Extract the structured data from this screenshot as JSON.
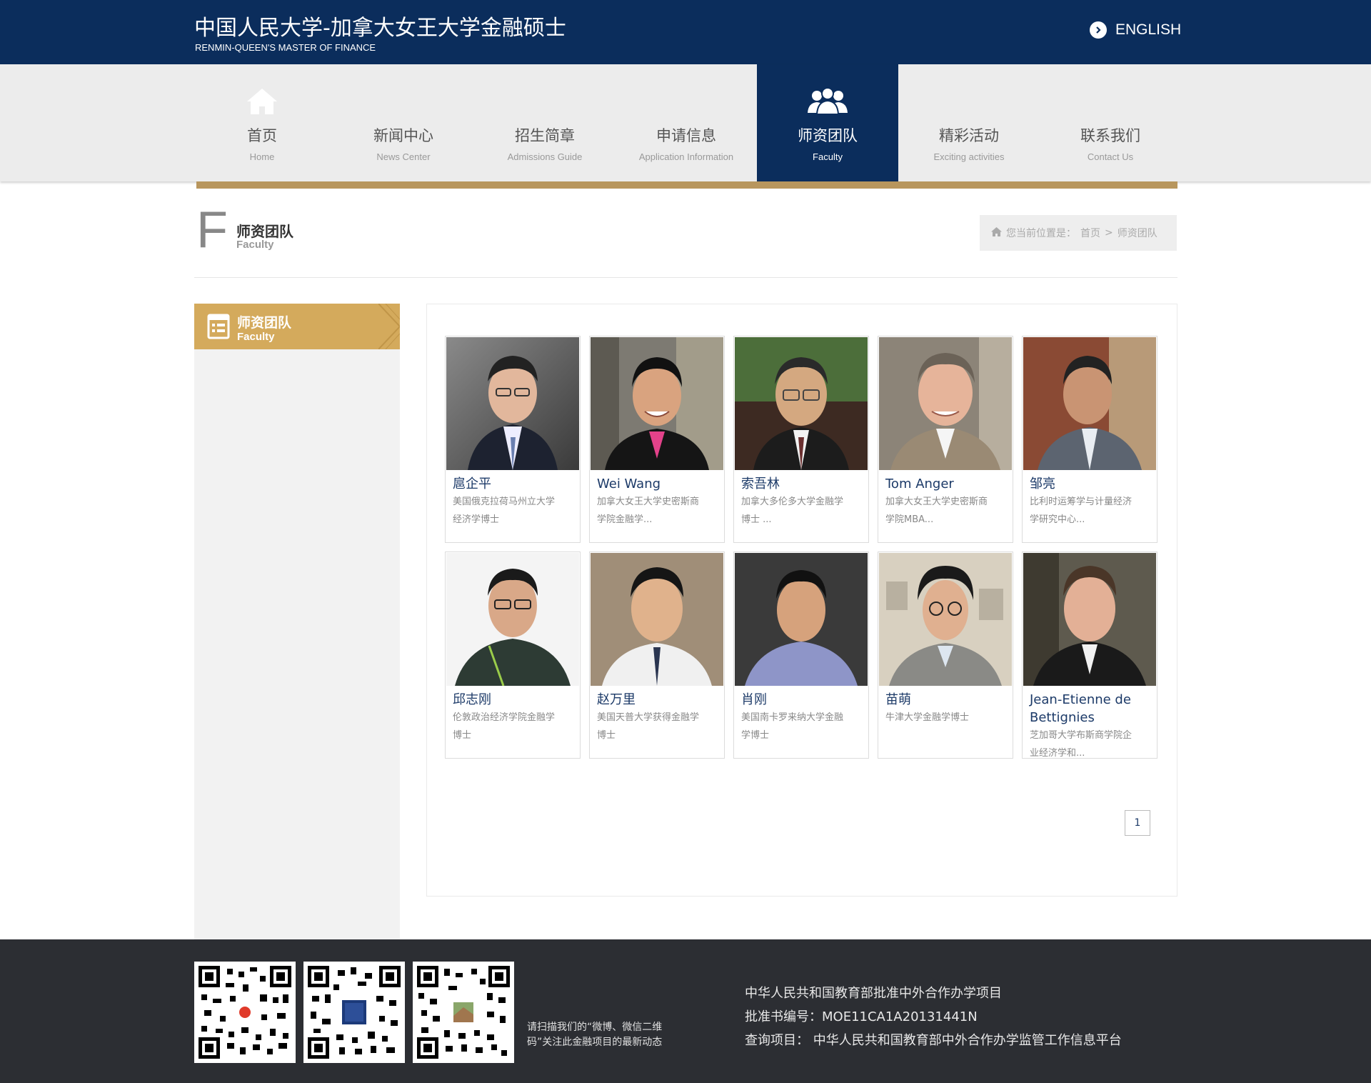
{
  "header": {
    "title": "中国人民大学-加拿大女王大学金融硕士",
    "subtitle": "RENMIN-QUEEN'S MASTER OF FINANCE",
    "language_link": "ENGLISH"
  },
  "nav": {
    "items": [
      {
        "zh": "首页",
        "en": "Home",
        "icon": "home-icon"
      },
      {
        "zh": "新闻中心",
        "en": "News Center"
      },
      {
        "zh": "招生简章",
        "en": "Admissions Guide"
      },
      {
        "zh": "申请信息",
        "en": "Application Information"
      },
      {
        "zh": "师资团队",
        "en": "Faculty",
        "icon": "faculty-group-icon",
        "active": true
      },
      {
        "zh": "精彩活动",
        "en": "Exciting activities"
      },
      {
        "zh": "联系我们",
        "en": "Contact Us"
      }
    ]
  },
  "page_title": {
    "letter": "F",
    "zh": "师资团队",
    "en": "Faculty"
  },
  "breadcrumb": {
    "prefix": "您当前位置是：",
    "home": "首页",
    "separator": ">",
    "current": "师资团队"
  },
  "sidebar": {
    "heading_zh": "师资团队",
    "heading_en": "Faculty",
    "accent_color": "#d4aa5c"
  },
  "faculty": [
    {
      "name": "扈企平",
      "desc_lines": [
        "美国俄克拉荷马州立大学",
        "经济学博士"
      ]
    },
    {
      "name": "Wei Wang",
      "desc_lines": [
        "加拿大女王大学史密斯商",
        "学院金融学..."
      ]
    },
    {
      "name": "索吾林",
      "desc_lines": [
        "加拿大多伦多大学金融学",
        "博士 ..."
      ]
    },
    {
      "name": "Tom Anger",
      "desc_lines": [
        "加拿大女王大学史密斯商",
        "学院MBA..."
      ]
    },
    {
      "name": "邹亮",
      "desc_lines": [
        "比利时运筹学与计量经济",
        "学研究中心..."
      ]
    },
    {
      "name": "邱志刚",
      "desc_lines": [
        "伦敦政治经济学院金融学",
        "博士"
      ]
    },
    {
      "name": "赵万里",
      "desc_lines": [
        "美国天普大学获得金融学",
        "博士"
      ]
    },
    {
      "name": "肖刚",
      "desc_lines": [
        "美国南卡罗来纳大学金融",
        "学博士"
      ]
    },
    {
      "name": "苗萌",
      "desc_lines": [
        "牛津大学金融学博士"
      ]
    },
    {
      "name": "Jean-Etienne de Bettignies",
      "desc_lines": [
        "芝加哥大学布斯商学院企",
        "业经济学和..."
      ]
    }
  ],
  "pagination": {
    "current_page": "1"
  },
  "footer": {
    "qr_note": "请扫描我们的“微博、微信二维码”关注此金融项目的最新动态",
    "line1": "中华人民共和国教育部批准中外合作办学项目",
    "line2": "批准书编号：MOE11CA1A20131441N",
    "line3_label": "查询项目：",
    "line3_link": "中华人民共和国教育部中外合作办学监管工作信息平台"
  },
  "colors": {
    "brand_navy": "#0b2d5c",
    "gold": "#b8965d",
    "footer_bg": "#2c2e33"
  }
}
